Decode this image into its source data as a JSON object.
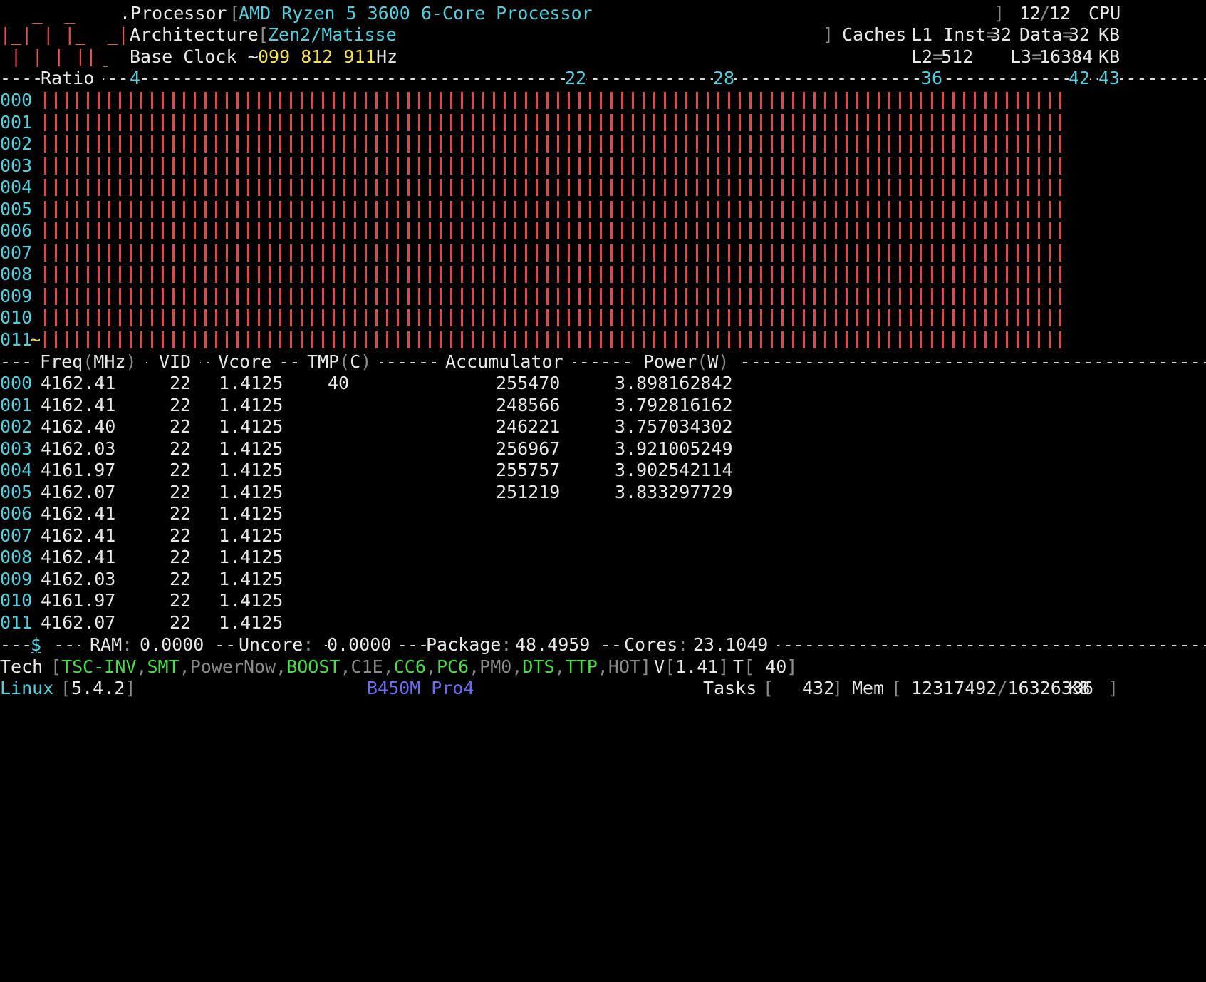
{
  "logo": [
    "   _  _ ",
    "|_| | |_  _|",
    " | | |_||_ "
  ],
  "processor": {
    "label": ".Processor",
    "value": "AMD Ryzen 5 3600 6-Core Processor",
    "count": "12",
    "total": "12",
    "unit": "CPU"
  },
  "architecture": {
    "label": "Architecture",
    "value": "Zen2/Matisse",
    "caches_label": "Caches",
    "l1_inst": "32",
    "l1_data": "32",
    "l2": "512",
    "l3": "16384",
    "kb": "KB"
  },
  "base_clock": {
    "label": "Base Clock ~",
    "value": "099 812 911",
    "unit": "Hz"
  },
  "ratio_header": {
    "label": "Ratio",
    "ticks": [
      "4",
      "22",
      "28",
      "36",
      "42",
      "43"
    ]
  },
  "cores": [
    "000",
    "001",
    "002",
    "003",
    "004",
    "005",
    "006",
    "007",
    "008",
    "009",
    "010",
    "011"
  ],
  "ratio_level": 0.91,
  "table_header": {
    "freq": "Freq",
    "freq_unit": "MHz",
    "vid": "VID",
    "vcore": "Vcore",
    "tmp": "TMP",
    "tmp_unit": "C",
    "acc": "Accumulator",
    "power": "Power",
    "power_unit": "W"
  },
  "rows": [
    {
      "core": "000",
      "freq": "4162.41",
      "vid": "22",
      "vcore": "1.4125",
      "tmp": "40",
      "acc": "255470",
      "power": "3.898162842"
    },
    {
      "core": "001",
      "freq": "4162.41",
      "vid": "22",
      "vcore": "1.4125",
      "tmp": "",
      "acc": "248566",
      "power": "3.792816162"
    },
    {
      "core": "002",
      "freq": "4162.40",
      "vid": "22",
      "vcore": "1.4125",
      "tmp": "",
      "acc": "246221",
      "power": "3.757034302"
    },
    {
      "core": "003",
      "freq": "4162.03",
      "vid": "22",
      "vcore": "1.4125",
      "tmp": "",
      "acc": "256967",
      "power": "3.921005249"
    },
    {
      "core": "004",
      "freq": "4161.97",
      "vid": "22",
      "vcore": "1.4125",
      "tmp": "",
      "acc": "255757",
      "power": "3.902542114"
    },
    {
      "core": "005",
      "freq": "4162.07",
      "vid": "22",
      "vcore": "1.4125",
      "tmp": "",
      "acc": "251219",
      "power": "3.833297729"
    },
    {
      "core": "006",
      "freq": "4162.41",
      "vid": "22",
      "vcore": "1.4125",
      "tmp": "",
      "acc": "",
      "power": ""
    },
    {
      "core": "007",
      "freq": "4162.41",
      "vid": "22",
      "vcore": "1.4125",
      "tmp": "",
      "acc": "",
      "power": ""
    },
    {
      "core": "008",
      "freq": "4162.41",
      "vid": "22",
      "vcore": "1.4125",
      "tmp": "",
      "acc": "",
      "power": ""
    },
    {
      "core": "009",
      "freq": "4162.03",
      "vid": "22",
      "vcore": "1.4125",
      "tmp": "",
      "acc": "",
      "power": ""
    },
    {
      "core": "010",
      "freq": "4161.97",
      "vid": "22",
      "vcore": "1.4125",
      "tmp": "",
      "acc": "",
      "power": ""
    },
    {
      "core": "011",
      "freq": "4162.07",
      "vid": "22",
      "vcore": "1.4125",
      "tmp": "",
      "acc": "",
      "power": ""
    }
  ],
  "summary": {
    "dollar": "$",
    "ram_label": "RAM",
    "ram": "0.0000",
    "uncore_label": "Uncore",
    "uncore": "0.0000",
    "package_label": "Package",
    "package": "48.4959",
    "cores_label": "Cores",
    "cores": "23.1049"
  },
  "tech": {
    "label": "Tech",
    "flags": [
      {
        "name": "TSC-INV",
        "on": true
      },
      {
        "name": "SMT",
        "on": true
      },
      {
        "name": "PowerNow",
        "on": false
      },
      {
        "name": "BOOST",
        "on": true
      },
      {
        "name": "C1E",
        "on": false
      },
      {
        "name": "CC6",
        "on": true
      },
      {
        "name": "PC6",
        "on": true
      },
      {
        "name": "PM0",
        "on": false
      },
      {
        "name": "DTS",
        "on": true
      },
      {
        "name": "TTP",
        "on": true
      },
      {
        "name": "HOT",
        "on": false
      }
    ],
    "v_label": "V",
    "v": "1.41",
    "t_label": "T",
    "t": " 40"
  },
  "footer": {
    "os": "Linux",
    "kernel": "5.4.2",
    "board": "B450M Pro4",
    "tasks_label": "Tasks",
    "tasks": "432",
    "mem_label": "Mem",
    "mem_used": "12317492",
    "mem_total": "16326336",
    "mem_unit": "KB"
  },
  "colors": {
    "on": "#46e046",
    "off": "#8a8a8a",
    "bar": "#e04848",
    "accent": "#4fd0e0"
  }
}
